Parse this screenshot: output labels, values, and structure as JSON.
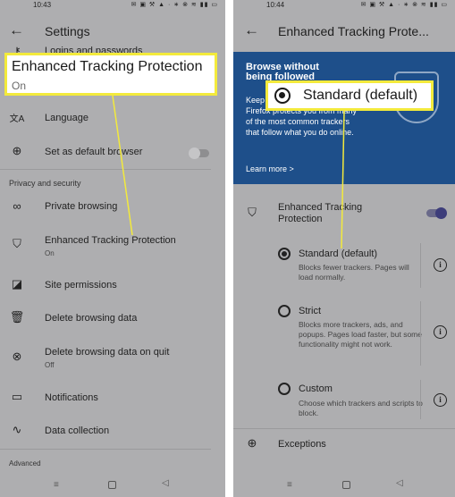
{
  "left": {
    "status": {
      "time": "10:43",
      "icons": "✉ ▣ ⚒ ▲ · ∗ ⊗ ≋ ▮▮ ▭"
    },
    "title": "Settings",
    "items": [
      {
        "label": "Logins and passwords",
        "icon": "key-icon",
        "glyph": "⚷"
      },
      {
        "label": "Language",
        "icon": "translate-icon",
        "glyph": "文A"
      },
      {
        "label": "Set as default browser",
        "icon": "globe-icon",
        "glyph": "⊕"
      },
      {
        "label": "Private browsing",
        "icon": "mask-icon",
        "glyph": "∞"
      },
      {
        "label": "Enhanced Tracking Protection",
        "sub": "On",
        "icon": "shield-icon",
        "glyph": "⛉"
      },
      {
        "label": "Site permissions",
        "icon": "permissions-icon",
        "glyph": "◪"
      },
      {
        "label": "Delete browsing data",
        "icon": "trash-icon",
        "glyph": "🗑"
      },
      {
        "label": "Delete browsing data on quit",
        "sub": "Off",
        "icon": "close-circle-icon",
        "glyph": "⊗"
      },
      {
        "label": "Notifications",
        "icon": "chat-icon",
        "glyph": "▭"
      },
      {
        "label": "Data collection",
        "icon": "chart-icon",
        "glyph": "∿"
      }
    ],
    "section_privacy": "Privacy and security",
    "section_advanced": "Advanced",
    "callout": {
      "title": "Enhanced Tracking Protection",
      "sub": "On"
    }
  },
  "right": {
    "status": {
      "time": "10:44",
      "icons": "✉ ▣ ⚒ ▲ · ∗ ⊗ ≋ ▮▮ ▭"
    },
    "title": "Enhanced Tracking Prote...",
    "banner": {
      "heading": "Browse without being followed",
      "text": "Keep your data to yourself. Firefox protects you from many of the most common trackers that follow what you do online.",
      "link": "Learn more  >"
    },
    "etp_label": "Enhanced Tracking Protection",
    "options": [
      {
        "title": "Standard (default)",
        "desc": "Blocks fewer trackers. Pages will load normally."
      },
      {
        "title": "Strict",
        "desc": "Blocks more trackers, ads, and popups. Pages load faster, but some functionality might not work."
      },
      {
        "title": "Custom",
        "desc": "Choose which trackers and scripts to block."
      }
    ],
    "exceptions": "Exceptions",
    "callout": {
      "title": "Standard (default)"
    }
  },
  "colors": {
    "highlight": "#f3ea3c",
    "banner": "#1e4f8a",
    "overlay": "#aeaeb0"
  }
}
